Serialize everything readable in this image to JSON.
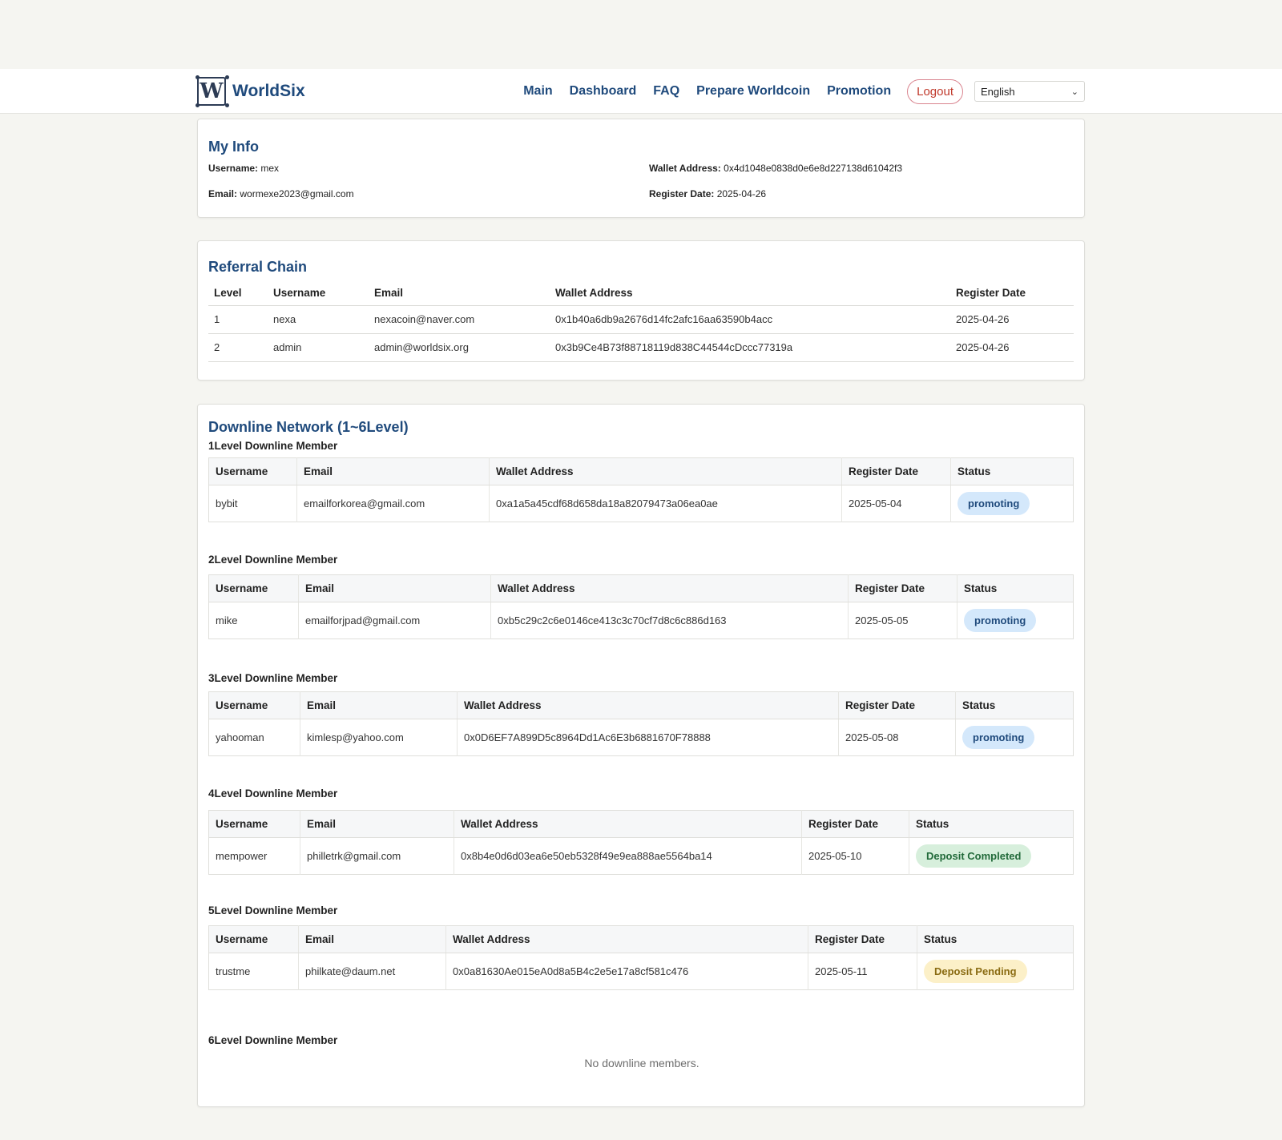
{
  "brand": {
    "name": "WorldSix",
    "logo_letter": "W"
  },
  "nav": {
    "links": [
      "Main",
      "Dashboard",
      "FAQ",
      "Prepare Worldcoin",
      "Promotion"
    ],
    "logout_label": "Logout",
    "language": "English"
  },
  "my_info": {
    "title": "My Info",
    "username_label": "Username:",
    "username": "mex",
    "email_label": "Email:",
    "email": "wormexe2023@gmail.com",
    "wallet_label": "Wallet Address:",
    "wallet": "0x4d1048e0838d0e6e8d227138d61042f3",
    "register_label": "Register Date:",
    "register_date": "2025-04-26"
  },
  "referral_chain": {
    "title": "Referral Chain",
    "columns": [
      "Level",
      "Username",
      "Email",
      "Wallet Address",
      "Register Date"
    ],
    "rows": [
      [
        "1",
        "nexa",
        "nexacoin@naver.com",
        "0x1b40a6db9a2676d14fc2afc16aa63590b4acc",
        "2025-04-26"
      ],
      [
        "2",
        "admin",
        "admin@worldsix.org",
        "0x3b9Ce4B73f88718119d838C44544cDccc77319a",
        "2025-04-26"
      ]
    ]
  },
  "downline": {
    "title": "Downline Network (1~6Level)",
    "columns": [
      "Username",
      "Email",
      "Wallet Address",
      "Register Date",
      "Status"
    ],
    "levels": [
      {
        "title": "1Level Downline Member",
        "rows": [
          {
            "username": "bybit",
            "email": "emailforkorea@gmail.com",
            "wallet": "0xa1a5a45cdf68d658da18a82079473a06ea0ae",
            "date": "2025-05-04",
            "status": "promoting",
            "status_type": "promoting"
          }
        ]
      },
      {
        "title": "2Level Downline Member",
        "rows": [
          {
            "username": "mike",
            "email": "emailforjpad@gmail.com",
            "wallet": "0xb5c29c2c6e0146ce413c3c70cf7d8c6c886d163",
            "date": "2025-05-05",
            "status": "promoting",
            "status_type": "promoting"
          }
        ]
      },
      {
        "title": "3Level Downline Member",
        "rows": [
          {
            "username": "yahooman",
            "email": "kimlesp@yahoo.com",
            "wallet": "0x0D6EF7A899D5c8964Dd1Ac6E3b6881670F78888",
            "date": "2025-05-08",
            "status": "promoting",
            "status_type": "promoting"
          }
        ]
      },
      {
        "title": "4Level Downline Member",
        "rows": [
          {
            "username": "mempower",
            "email": "philletrk@gmail.com",
            "wallet": "0x8b4e0d6d03ea6e50eb5328f49e9ea888ae5564ba14",
            "date": "2025-05-10",
            "status": "Deposit Completed",
            "status_type": "completed"
          }
        ]
      },
      {
        "title": "5Level Downline Member",
        "rows": [
          {
            "username": "trustme",
            "email": "philkate@daum.net",
            "wallet": "0x0a81630Ae015eA0d8a5B4c2e5e17a8cf581c476",
            "date": "2025-05-11",
            "status": "Deposit Pending",
            "status_type": "pending"
          }
        ]
      },
      {
        "title": "6Level Downline Member",
        "rows": [],
        "empty_message": "No downline members."
      }
    ]
  },
  "colors": {
    "primary": "#1f4a7c",
    "danger": "#c0392b",
    "background": "#f5f5f1"
  }
}
